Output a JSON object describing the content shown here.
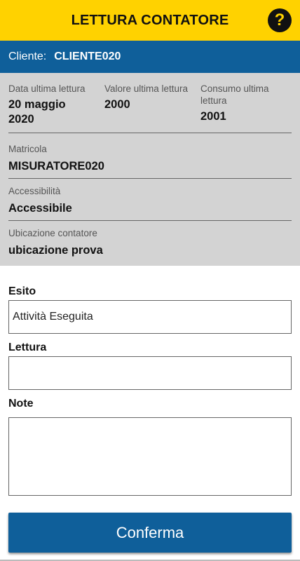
{
  "header": {
    "title": "LETTURA CONTATORE",
    "help_icon": "help-icon",
    "help_glyph": "?"
  },
  "client": {
    "label": "Cliente:",
    "value": "CLIENTE020"
  },
  "info": {
    "last_reading_date": {
      "label": "Data ultima lettura",
      "value": "20 maggio 2020"
    },
    "last_reading_value": {
      "label": "Valore ultima lettura",
      "value": "2000"
    },
    "last_reading_consumption": {
      "label": "Consumo ultima lettura",
      "value": "2001"
    },
    "serial": {
      "label": "Matricola",
      "value": "MISURATORE020"
    },
    "accessibility": {
      "label": "Accessibilità",
      "value": "Accessibile"
    },
    "location": {
      "label": "Ubicazione contatore",
      "value": "ubicazione prova"
    }
  },
  "form": {
    "outcome": {
      "label": "Esito",
      "value": "Attività Eseguita"
    },
    "reading": {
      "label": "Lettura",
      "value": ""
    },
    "notes": {
      "label": "Note",
      "value": ""
    }
  },
  "actions": {
    "confirm_label": "Conferma"
  },
  "colors": {
    "header_bg": "#ffd200",
    "primary": "#0f5f9a",
    "info_bg": "#d3d3d3"
  }
}
